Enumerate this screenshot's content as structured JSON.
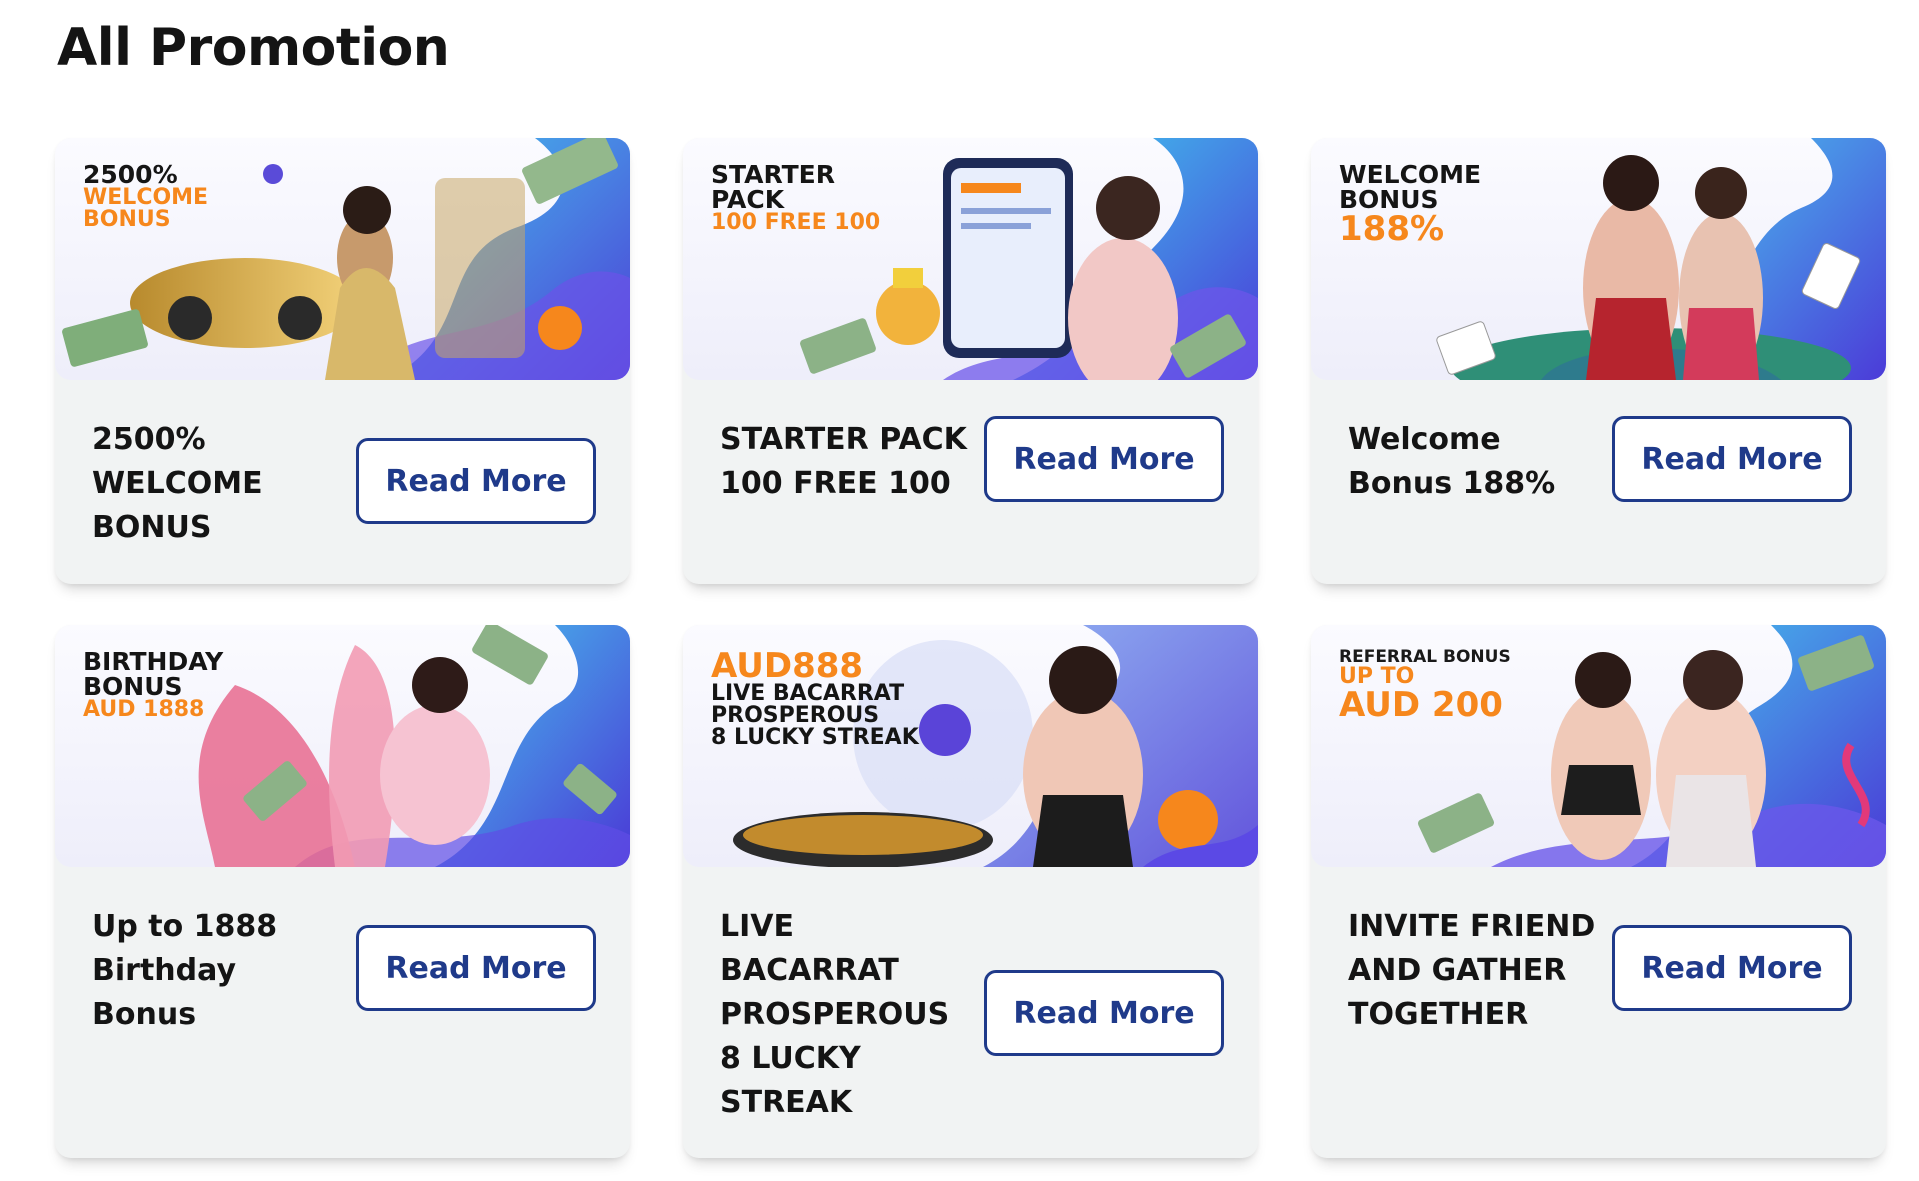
{
  "page": {
    "title": "All Promotion"
  },
  "read_more_label": "Read More",
  "colors": {
    "accent": "#1f3a8a",
    "orange": "#f6871c",
    "card_bg": "#f1f3f3"
  },
  "promotions": [
    {
      "banner": {
        "lines": [
          "2500%",
          "WELCOME",
          "BONUS"
        ]
      },
      "title_lines": [
        "2500%",
        "WELCOME",
        "BONUS"
      ]
    },
    {
      "banner": {
        "lines": [
          "STARTER",
          "PACK",
          "100 FREE 100"
        ]
      },
      "title_lines": [
        "STARTER PACK",
        "100 FREE 100"
      ]
    },
    {
      "banner": {
        "lines": [
          "WELCOME",
          "BONUS",
          "188%"
        ]
      },
      "title_lines": [
        "Welcome",
        "Bonus 188%"
      ]
    },
    {
      "banner": {
        "lines": [
          "BIRTHDAY",
          "BONUS",
          "AUD 1888"
        ]
      },
      "title_lines": [
        "Up to 1888",
        "Birthday",
        "Bonus"
      ]
    },
    {
      "banner": {
        "lines": [
          "AUD888",
          "LIVE BACARRAT",
          "PROSPEROUS",
          "8 LUCKY STREAK"
        ]
      },
      "title_lines": [
        "LIVE",
        "BACARRAT",
        "PROSPEROUS",
        "8 LUCKY",
        "STREAK"
      ]
    },
    {
      "banner": {
        "lines": [
          "REFERRAL BONUS",
          "UP TO",
          "AUD 200"
        ]
      },
      "title_lines": [
        "INVITE FRIEND",
        "AND GATHER",
        "TOGETHER"
      ]
    }
  ]
}
